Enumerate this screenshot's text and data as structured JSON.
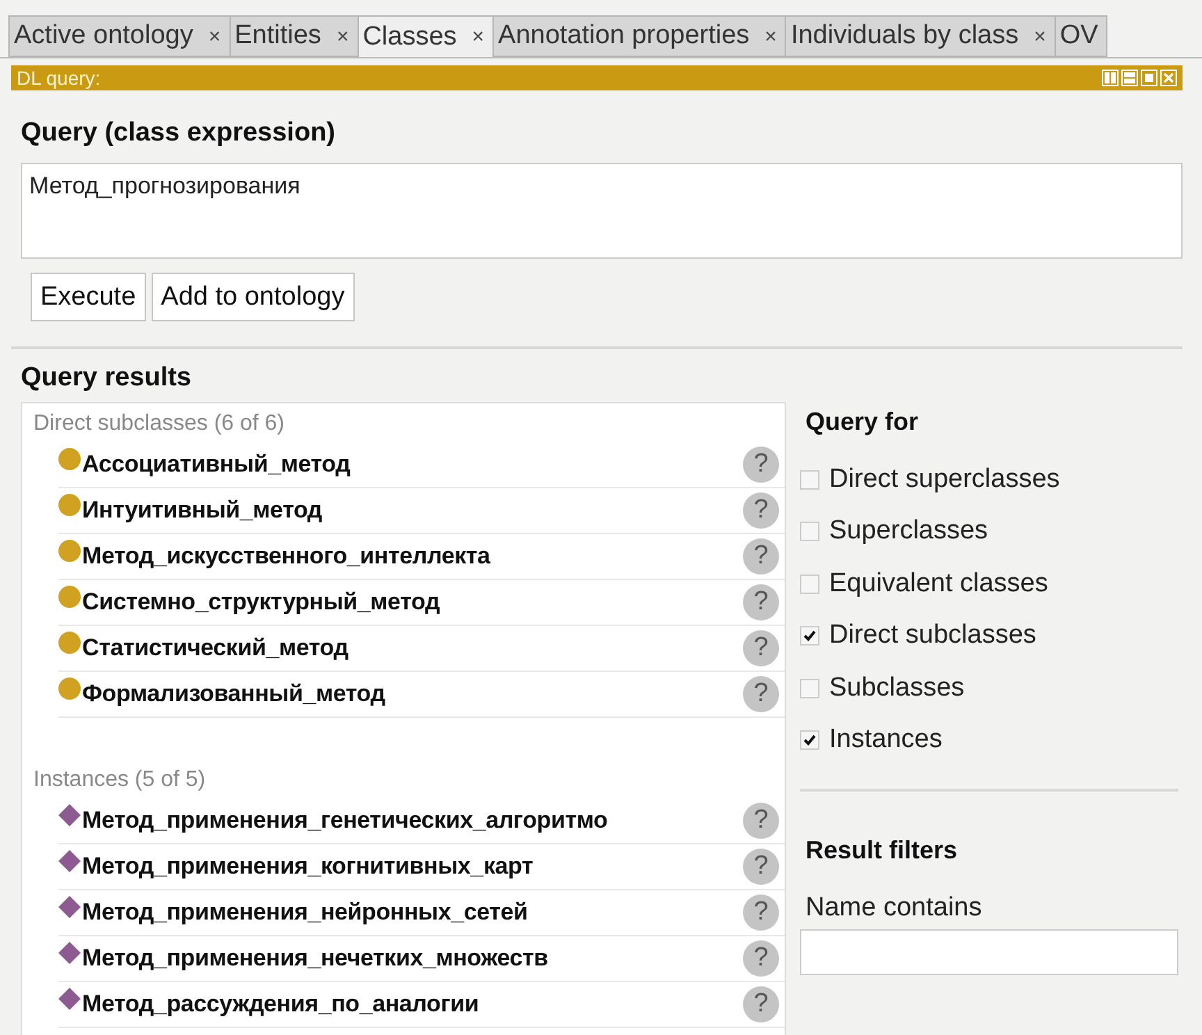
{
  "tabs": [
    {
      "label": "Active ontology",
      "selected": false,
      "closable": true
    },
    {
      "label": "Entities",
      "selected": false,
      "closable": true
    },
    {
      "label": "Classes",
      "selected": true,
      "closable": true
    },
    {
      "label": "Annotation properties",
      "selected": false,
      "closable": true
    },
    {
      "label": "Individuals by class",
      "selected": false,
      "closable": true
    },
    {
      "label": "OV",
      "selected": false,
      "closable": false
    }
  ],
  "close_glyph": "×",
  "view": {
    "title": "DL query:"
  },
  "query": {
    "heading": "Query (class expression)",
    "value": "Метод_прогнозирования",
    "buttons": [
      "Execute",
      "Add to ontology"
    ]
  },
  "results": {
    "heading": "Query results",
    "sections": [
      {
        "title": "Direct subclasses (6 of 6)",
        "kind": "class",
        "items": [
          "Ассоциативный_метод",
          "Интуитивный_метод",
          "Метод_искусственного_интеллекта",
          "Системно_структурный_метод",
          "Статистический_метод",
          "Формализованный_метод"
        ]
      },
      {
        "title": "Instances (5 of 5)",
        "kind": "individual",
        "items": [
          "Метод_применения_генетических_алгоритмо",
          "Метод_применения_когнитивных_карт",
          "Метод_применения_нейронных_сетей",
          "Метод_применения_нечетких_множеств",
          "Метод_рассуждения_по_аналогии"
        ]
      }
    ],
    "help_glyph": "?"
  },
  "query_for": {
    "heading": "Query for",
    "options": [
      {
        "label": "Direct superclasses",
        "checked": false
      },
      {
        "label": "Superclasses",
        "checked": false
      },
      {
        "label": "Equivalent classes",
        "checked": false
      },
      {
        "label": "Direct subclasses",
        "checked": true
      },
      {
        "label": "Subclasses",
        "checked": false
      },
      {
        "label": "Instances",
        "checked": true
      }
    ]
  },
  "filters": {
    "heading": "Result filters",
    "name_label": "Name contains"
  }
}
